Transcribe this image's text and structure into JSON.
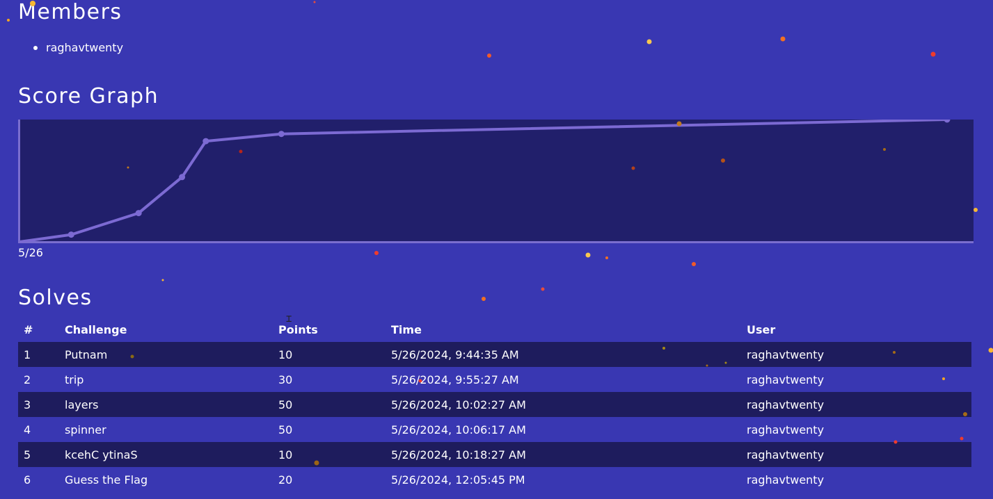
{
  "members": {
    "title": "Members",
    "items": [
      "raghavtwenty"
    ]
  },
  "score_graph": {
    "title": "Score Graph",
    "date_label": "5/26",
    "line_color": "#7c6ad3",
    "plot_bg": "#211f6b",
    "axis_color": "#7a6ecf"
  },
  "chart_data": {
    "type": "line",
    "title": "Score Graph",
    "xlabel": "",
    "ylabel": "",
    "tick_labels": [
      "5/26"
    ],
    "x": [
      "5/26/2024, 9:44:35 AM",
      "5/26/2024, 9:55:27 AM",
      "5/26/2024, 10:02:27 AM",
      "5/26/2024, 10:06:17 AM",
      "5/26/2024, 10:18:27 AM",
      "5/26/2024, 12:05:45 PM"
    ],
    "values": [
      10,
      40,
      90,
      140,
      150,
      170
    ],
    "ylim": [
      0,
      170
    ],
    "grid": false
  },
  "solves": {
    "title": "Solves",
    "columns": [
      "#",
      "Challenge",
      "Points",
      "Time",
      "User"
    ],
    "rows": [
      [
        "1",
        "Putnam",
        "10",
        "5/26/2024, 9:44:35 AM",
        "raghavtwenty"
      ],
      [
        "2",
        "trip",
        "30",
        "5/26/2024, 9:55:27 AM",
        "raghavtwenty"
      ],
      [
        "3",
        "layers",
        "50",
        "5/26/2024, 10:02:27 AM",
        "raghavtwenty"
      ],
      [
        "4",
        "spinner",
        "50",
        "5/26/2024, 10:06:17 AM",
        "raghavtwenty"
      ],
      [
        "5",
        "kcehC ytinaS",
        "10",
        "5/26/2024, 10:18:27 AM",
        "raghavtwenty"
      ],
      [
        "6",
        "Guess the Flag",
        "20",
        "5/26/2024, 12:05:45 PM",
        "raghavtwenty"
      ]
    ]
  },
  "colors": {
    "page_bg": "#3937b2",
    "row_alt_bg": "#1e1c5d"
  },
  "cursor_icon": "text-cursor-icon"
}
